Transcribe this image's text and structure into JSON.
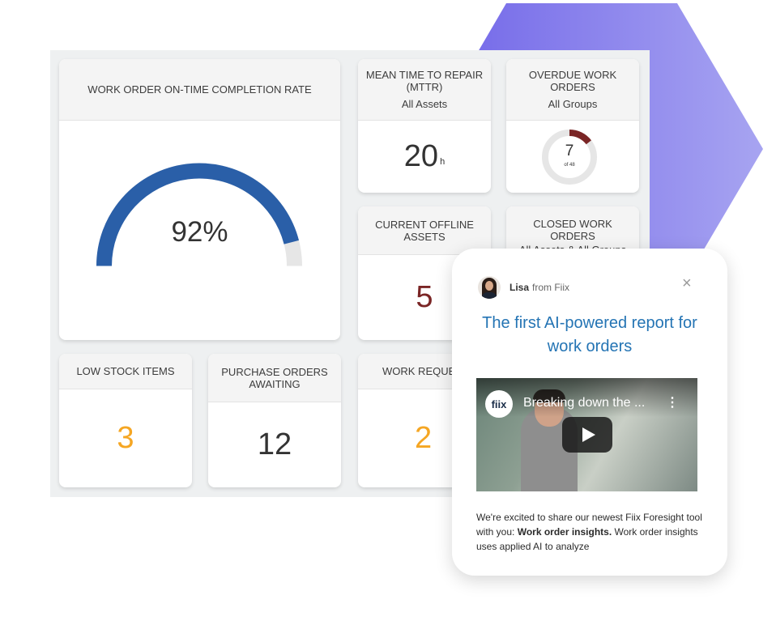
{
  "colors": {
    "accent_blue": "#2a5fa8",
    "gauge_track": "#e6e6e6",
    "orange_value": "#f5a623",
    "offline_value": "#7a2525",
    "hex_shape": "#8b7bf0",
    "popup_headline": "#2474b4"
  },
  "dashboard": {
    "completion": {
      "title": "WORK ORDER ON-TIME COMPLETION RATE",
      "value": "92%",
      "fraction": 0.92
    },
    "mttr": {
      "title": "MEAN TIME TO REPAIR (MTTR)",
      "subtitle": "All Assets",
      "value": "20",
      "unit": "h"
    },
    "overdue": {
      "title": "OVERDUE WORK ORDERS",
      "subtitle": "All Groups",
      "value": "7",
      "of_label": "of 48",
      "fraction": 0.146
    },
    "offline": {
      "title": "CURRENT OFFLINE ASSETS",
      "value": "5"
    },
    "closed": {
      "title": "CLOSED WORK ORDERS",
      "subtitle": "All Assets & All Groups"
    },
    "low_stock": {
      "title": "LOW STOCK ITEMS",
      "value": "3"
    },
    "purchase_orders": {
      "title": "PURCHASE ORDERS AWAITING",
      "value": "12"
    },
    "work_requests": {
      "title": "WORK REQUES",
      "value": "2"
    }
  },
  "popup": {
    "sender_name": "Lisa",
    "sender_suffix": "from Fiix",
    "close_icon": "×",
    "headline": "The first AI-powered report for work orders",
    "video": {
      "logo": "fiix",
      "title": "Breaking down the ...",
      "menu_icon": "⋮"
    },
    "message_pre": "We're excited to share our newest Fiix Foresight tool with you: ",
    "message_bold": "Work order insights.",
    "message_post": " Work order insights uses applied AI to analyze"
  }
}
